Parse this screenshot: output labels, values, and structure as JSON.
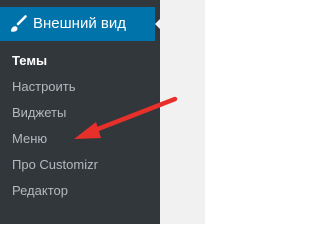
{
  "menu": {
    "title": "Внешний вид",
    "icon": "paintbrush-icon",
    "accent_color": "#0073aa",
    "items": [
      {
        "label": "Темы",
        "current": true
      },
      {
        "label": "Настроить",
        "current": false
      },
      {
        "label": "Виджеты",
        "current": false
      },
      {
        "label": "Меню",
        "current": false
      },
      {
        "label": "Про Customizr",
        "current": false
      },
      {
        "label": "Редактор",
        "current": false
      }
    ]
  },
  "annotation": {
    "type": "arrow",
    "color": "#e8302a",
    "points_to": "Меню"
  }
}
